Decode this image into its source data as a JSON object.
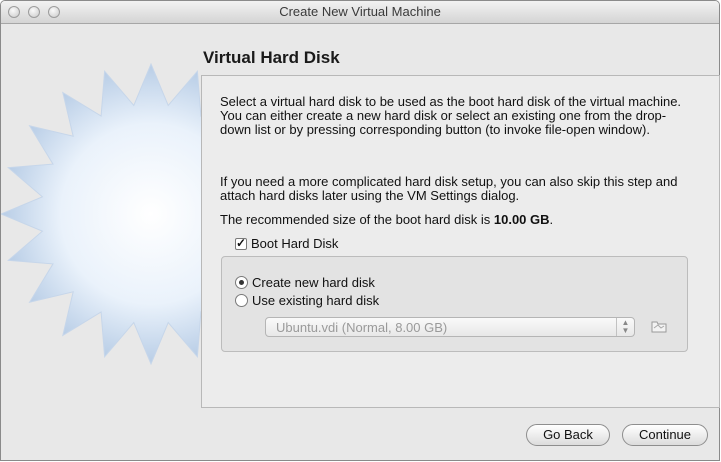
{
  "window": {
    "title": "Create New Virtual Machine"
  },
  "page": {
    "heading": "Virtual Hard Disk",
    "para1": "Select a virtual hard disk to be used as the boot hard disk of the virtual machine. You can either create a new hard disk or select an existing one from the drop-down list or by pressing corresponding button (to invoke file-open window).",
    "para2": "If you need a more complicated hard disk setup, you can also skip this step and attach hard disks later using the VM Settings dialog.",
    "recommended_prefix": "The recommended size of the boot hard disk is ",
    "recommended_value": "10.00 GB",
    "recommended_suffix": "."
  },
  "boot_disk": {
    "label": "Boot Hard Disk",
    "checked": true
  },
  "options": {
    "create_new": {
      "label": "Create new hard disk",
      "selected": true
    },
    "use_existing": {
      "label": "Use existing hard disk",
      "selected": false
    },
    "existing_select_value": "Ubuntu.vdi (Normal, 8.00 GB)"
  },
  "buttons": {
    "back": "Go Back",
    "continue": "Continue"
  }
}
